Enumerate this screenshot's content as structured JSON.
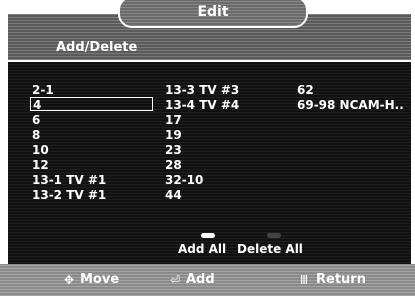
{
  "window": {
    "title": "Edit"
  },
  "section": {
    "label": "Add/Delete"
  },
  "channels": {
    "col1": [
      "2-1",
      "4",
      "6",
      "8",
      "10",
      "12",
      "13-1 TV #1",
      "13-2 TV #1"
    ],
    "col2": [
      "13-3 TV #3",
      "13-4 TV #4",
      "17",
      "19",
      "23",
      "28",
      "32-10",
      "44"
    ],
    "col3": [
      "62",
      "69-98 NCAM-H.."
    ]
  },
  "selected": {
    "channel": "4"
  },
  "actions": {
    "add_all": {
      "label": "Add All",
      "color": "#ffffff"
    },
    "delete_all": {
      "label": "Delete All",
      "color": "#444444"
    }
  },
  "footer": {
    "move": {
      "label": "Move",
      "icon": "move-arrows-icon"
    },
    "add": {
      "label": "Add",
      "icon": "enter-icon"
    },
    "return": {
      "label": "Return",
      "icon": "return-icon"
    }
  }
}
